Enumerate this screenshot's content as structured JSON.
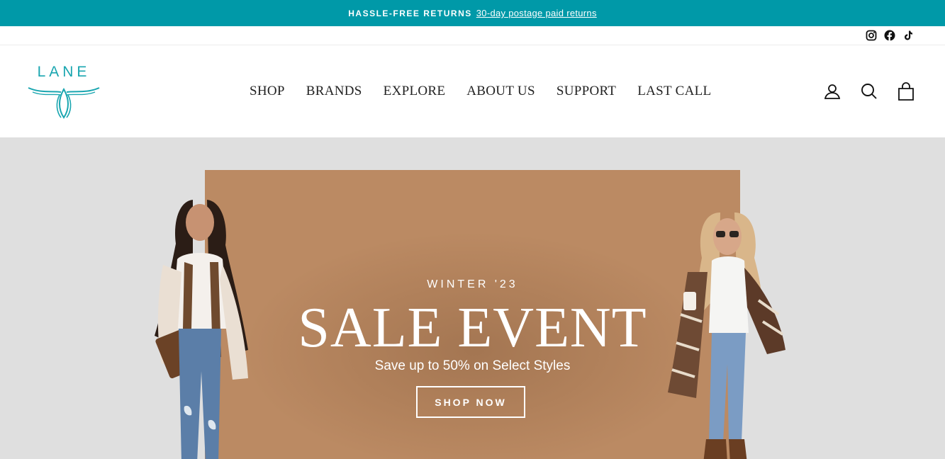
{
  "announcement": {
    "label": "HASSLE-FREE RETURNS",
    "link_text": "30-day postage paid returns"
  },
  "social": {
    "icons": [
      "instagram-icon",
      "facebook-icon",
      "tiktok-icon"
    ]
  },
  "brand": {
    "logo_text": "LANE",
    "accent_color": "#1aa6b0",
    "bar_color": "#0099a8"
  },
  "nav": {
    "items": [
      "SHOP",
      "BRANDS",
      "EXPLORE",
      "ABOUT US",
      "SUPPORT",
      "LAST CALL"
    ]
  },
  "header_icons": [
    "account-icon",
    "search-icon",
    "cart-icon"
  ],
  "hero": {
    "eyebrow": "WINTER '23",
    "headline": "SALE EVENT",
    "subheadline": "Save up to 50% on Select Styles",
    "cta": "SHOP NOW",
    "panel_color": "#bb8a63",
    "background_color": "#dfdfdf"
  }
}
